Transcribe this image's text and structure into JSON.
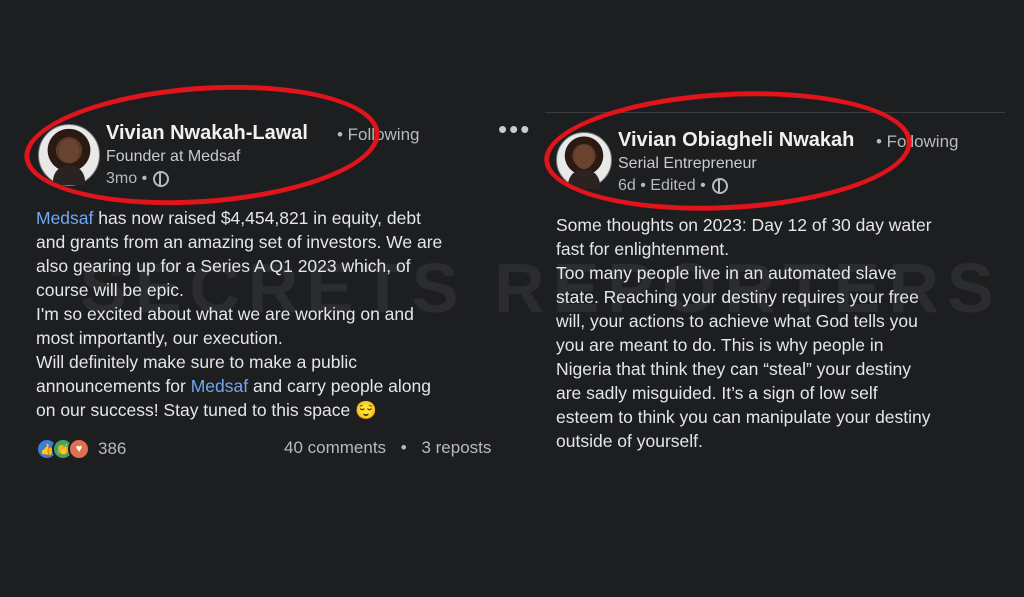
{
  "watermark": "SECRETS REPORTERS",
  "left_post": {
    "author_name": "Vivian Nwakah-Lawal",
    "follow_status": "• Following",
    "headline": "Founder at Medsaf",
    "time": "3mo •",
    "body_lines": [
      [
        "Medsaf",
        " has now raised $4,454,821 in equity, debt"
      ],
      [
        "",
        "and grants from an amazing set of investors. We are"
      ],
      [
        "",
        "also gearing up for a Series A Q1 2023 which, of"
      ],
      [
        "",
        "course will be epic."
      ],
      [
        "",
        " I'm so excited about what we are working on and"
      ],
      [
        "",
        "most importantly, our execution."
      ],
      [
        "",
        " Will definitely make sure to make a public"
      ],
      [
        "",
        "announcements for "
      ],
      [
        "",
        "on our success! Stay tuned to this space 😌"
      ]
    ],
    "line8_link": "Medsaf",
    "line8_rest": " and carry people along",
    "reaction_count": "386",
    "comments": "40 comments",
    "reposts": "3 reposts",
    "social_separator": "•"
  },
  "right_post": {
    "author_name": "Vivian Obiagheli Nwakah",
    "follow_status": "• Following",
    "headline": "Serial Entrepreneur",
    "time": "6d • Edited •",
    "body_lines": [
      "Some thoughts on 2023: Day 12 of 30 day water",
      "fast for enlightenment.",
      "Too many people live in an automated slave",
      "state. Reaching your destiny requires your free",
      "will, your actions to achieve what God tells you",
      "you are meant to do. This is why people in",
      "Nigeria that think they can “steal” your destiny",
      "are sadly misguided. It’s a sign of low self",
      "esteem to think you can manipulate your destiny",
      "outside of yourself."
    ]
  },
  "icons": {
    "more": "more-options-icon",
    "globe": "globe-icon",
    "like": "like-reaction-icon",
    "celebrate": "celebrate-reaction-icon",
    "love": "love-reaction-icon"
  },
  "colors": {
    "background": "#1d1e20",
    "link": "#72a7f2",
    "annotation_circle": "#e0141a"
  }
}
